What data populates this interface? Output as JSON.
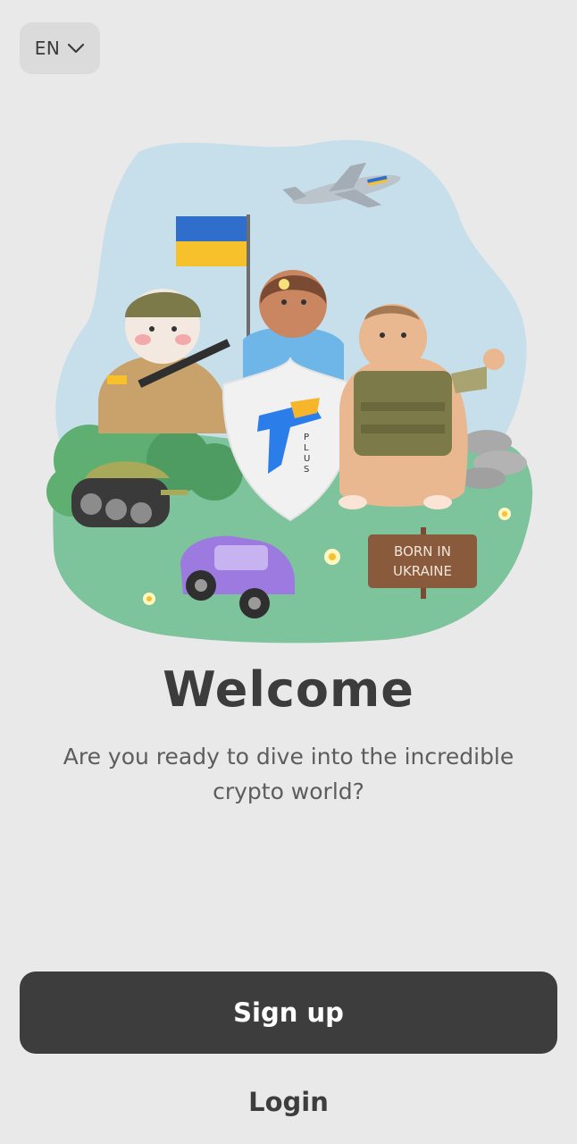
{
  "language": {
    "selected": "EN",
    "icon": "chevron-down-icon"
  },
  "illustration": {
    "sign_line1": "BORN IN",
    "sign_line2": "UKRAINE",
    "logo_letters": [
      "P",
      "L",
      "U",
      "S"
    ]
  },
  "welcome": {
    "title": "Welcome",
    "subtitle": "Are you ready to dive into the incredible crypto world?"
  },
  "actions": {
    "signup_label": "Sign up",
    "login_label": "Login"
  },
  "colors": {
    "background": "#e9e9e9",
    "primary_button": "#3d3d3d",
    "flag_blue": "#2f6fcb",
    "flag_yellow": "#f6c12a",
    "logo_blue": "#2b7de9",
    "logo_yellow": "#f7b52b"
  }
}
